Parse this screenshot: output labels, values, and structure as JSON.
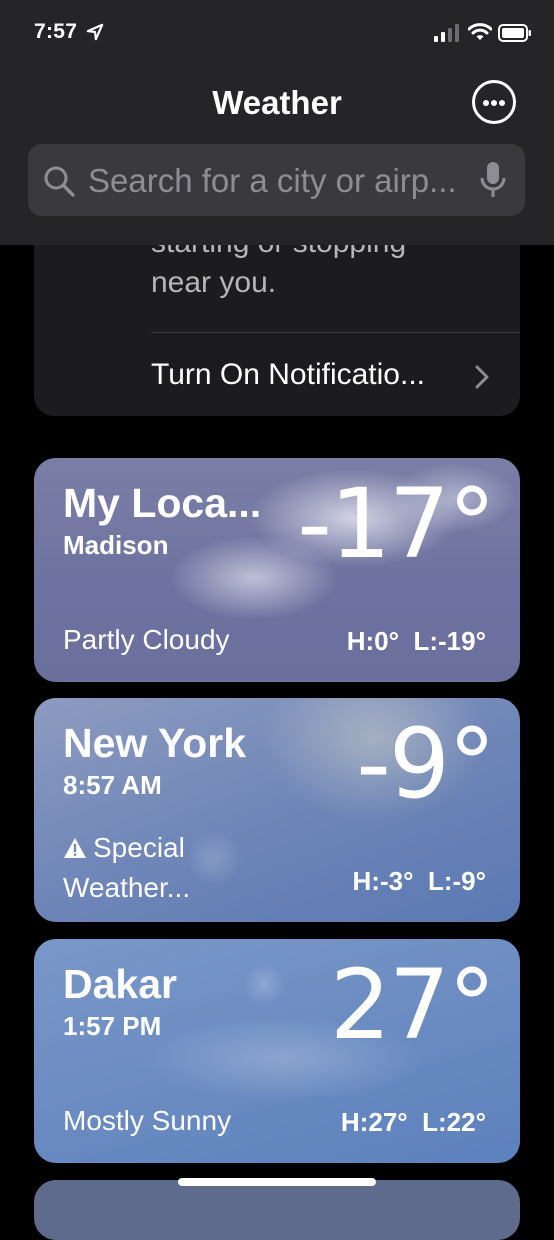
{
  "status_bar": {
    "time": "7:57"
  },
  "header": {
    "title": "Weather"
  },
  "search": {
    "placeholder": "Search for a city or airp..."
  },
  "notification_card": {
    "partial_text": "starting or stopping",
    "text": "near you.",
    "link": "Turn On Notificatio..."
  },
  "cities": [
    {
      "name": "My Loca...",
      "subtitle": "Madison",
      "temp": "-17°",
      "condition": "Partly Cloudy",
      "high": "H:0°",
      "low": "L:-19°"
    },
    {
      "name": "New York",
      "subtitle": "8:57 AM",
      "temp": "-9°",
      "alert_line1": "Special",
      "alert_line2": "Weather...",
      "high": "H:-3°",
      "low": "L:-9°"
    },
    {
      "name": "Dakar",
      "subtitle": "1:57 PM",
      "temp": "27°",
      "condition": "Mostly Sunny",
      "high": "H:27°",
      "low": "L:22°"
    }
  ]
}
